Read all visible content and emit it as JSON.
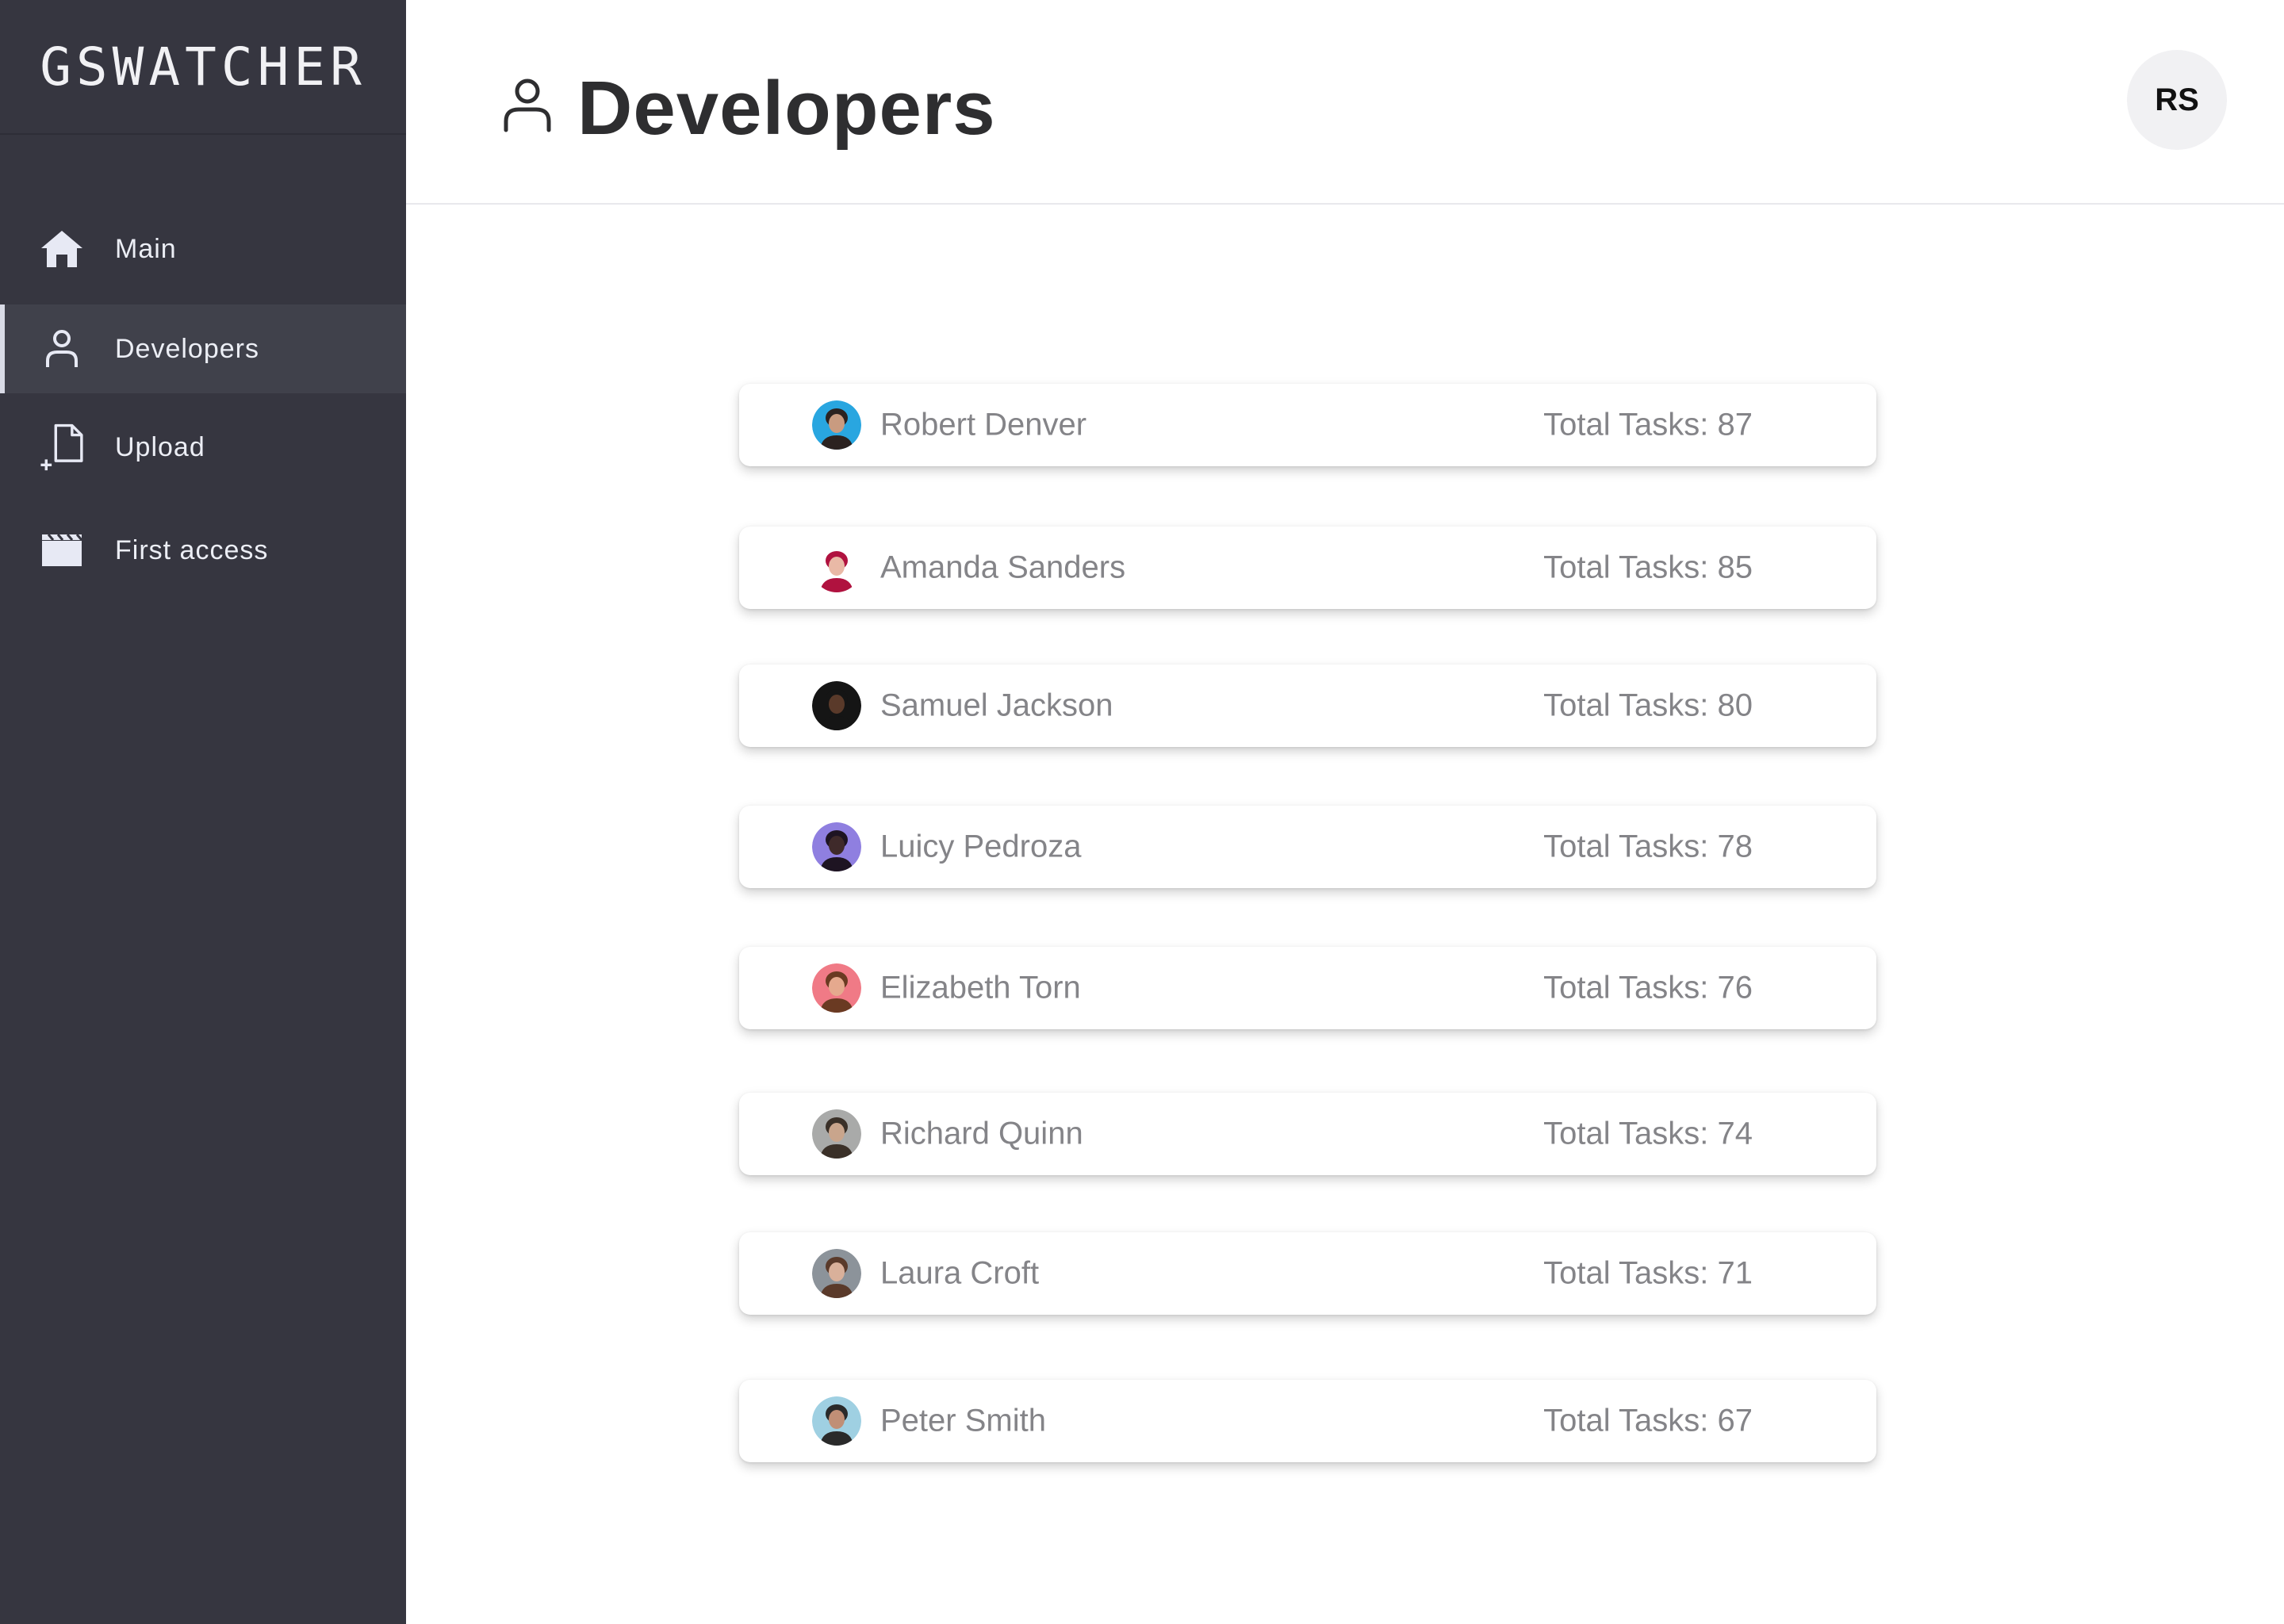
{
  "app": {
    "logo": "GSWATCHER"
  },
  "sidebar": {
    "items": [
      {
        "label": "Main",
        "icon": "home-icon"
      },
      {
        "label": "Developers",
        "icon": "user-icon",
        "active": true
      },
      {
        "label": "Upload",
        "icon": "upload-file-icon"
      },
      {
        "label": "First access",
        "icon": "clapperboard-icon"
      }
    ]
  },
  "header": {
    "title": "Developers",
    "title_icon": "user-icon",
    "user_initials": "RS"
  },
  "developers": [
    {
      "name": "Robert Denver",
      "tasks": "Total Tasks: 87",
      "avatar_bg": "#29a6e0",
      "skin": "#c99b80",
      "hair": "#2b2220"
    },
    {
      "name": "Amanda Sanders",
      "tasks": "Total Tasks: 85",
      "avatar_bg": "#ffffff",
      "skin": "#e9b9a6",
      "hair": "#b0123f"
    },
    {
      "name": "Samuel Jackson",
      "tasks": "Total Tasks: 80",
      "avatar_bg": "#151515",
      "skin": "#5a3a2a",
      "hair": "#151515"
    },
    {
      "name": "Luicy Pedroza",
      "tasks": "Total Tasks: 78",
      "avatar_bg": "#8f7fe0",
      "skin": "#3f2a2a",
      "hair": "#1e1422"
    },
    {
      "name": "Elizabeth Torn",
      "tasks": "Total Tasks: 76",
      "avatar_bg": "#f07a86",
      "skin": "#e5a98e",
      "hair": "#6a3a22"
    },
    {
      "name": "Richard Quinn",
      "tasks": "Total Tasks: 74",
      "avatar_bg": "#a9aaa9",
      "skin": "#c9a58c",
      "hair": "#3a3028"
    },
    {
      "name": "Laura Croft",
      "tasks": "Total Tasks: 71",
      "avatar_bg": "#8c939a",
      "skin": "#d9b09a",
      "hair": "#5a3a2a"
    },
    {
      "name": "Peter Smith",
      "tasks": "Total Tasks: 67",
      "avatar_bg": "#9fd0e2",
      "skin": "#c08f76",
      "hair": "#2a2a2a"
    }
  ],
  "colors": {
    "sidebar_bg": "#363640",
    "sidebar_active_bg": "#40414b",
    "text_muted": "#848488",
    "title": "#2e2e30"
  }
}
